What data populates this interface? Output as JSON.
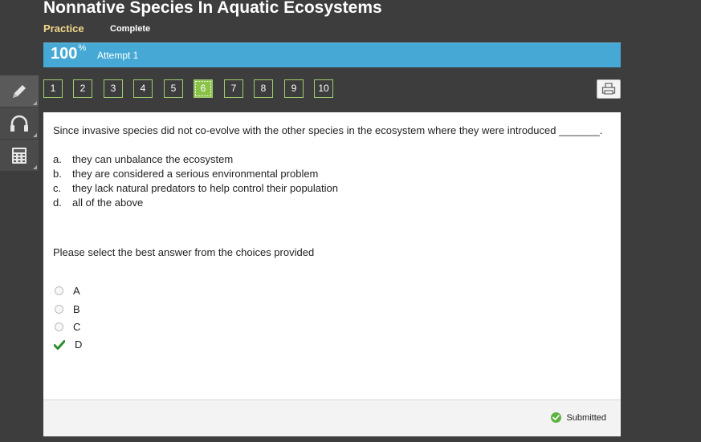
{
  "header": {
    "title": "Nonnative Species In Aquatic Ecosystems",
    "tabs": [
      {
        "label": "Practice",
        "active": true
      },
      {
        "label": "Complete",
        "active": false
      }
    ]
  },
  "progress": {
    "percent": "100",
    "percent_sign": "%",
    "attempt": "Attempt 1",
    "bar_color": "#46a9d5"
  },
  "toolbar": {
    "tools": [
      {
        "icon": "pencil-icon",
        "active": true
      },
      {
        "icon": "headphones-icon",
        "active": false
      },
      {
        "icon": "calculator-icon",
        "active": false
      }
    ]
  },
  "question_nav": {
    "items": [
      "1",
      "2",
      "3",
      "4",
      "5",
      "6",
      "7",
      "8",
      "9",
      "10"
    ],
    "current": "6",
    "accent": "#8bc34a"
  },
  "question": {
    "text": "Since invasive species did not co-evolve with the other species in the ecosystem where they were introduced _______.",
    "choices": [
      {
        "letter": "a.",
        "text": "they can unbalance the ecosystem"
      },
      {
        "letter": "b.",
        "text": "they are considered a serious environmental problem"
      },
      {
        "letter": "c.",
        "text": "they lack natural predators to help control their population"
      },
      {
        "letter": "d.",
        "text": "all of the above"
      }
    ],
    "prompt": "Please select the best answer from the choices provided"
  },
  "answers": {
    "options": [
      "A",
      "B",
      "C",
      "D"
    ],
    "selected": "D"
  },
  "footer": {
    "status": "Submitted",
    "status_color": "#5cb342"
  }
}
